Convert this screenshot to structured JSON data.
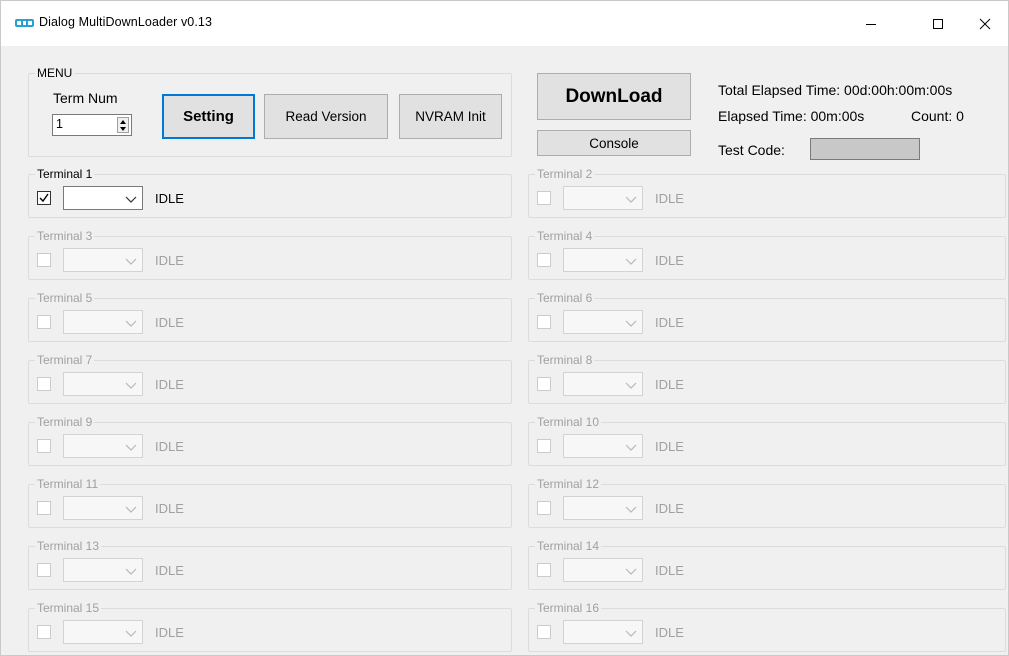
{
  "window": {
    "title": "Dialog MultiDownLoader v0.13"
  },
  "menu": {
    "legend": "MENU",
    "term_num_label": "Term Num",
    "term_num_value": "1",
    "setting_label": "Setting",
    "read_version_label": "Read Version",
    "nvram_init_label": "NVRAM Init"
  },
  "actions": {
    "download_label": "DownLoad",
    "console_label": "Console"
  },
  "info": {
    "total_elapsed": "Total Elapsed Time: 00d:00h:00m:00s",
    "elapsed": "Elapsed Time: 00m:00s",
    "count": "Count: 0",
    "test_code_label": "Test Code:"
  },
  "terminals": [
    {
      "name": "Terminal 1",
      "status": "IDLE",
      "checked": true,
      "enabled": true
    },
    {
      "name": "Terminal 2",
      "status": "IDLE",
      "checked": false,
      "enabled": false
    },
    {
      "name": "Terminal 3",
      "status": "IDLE",
      "checked": false,
      "enabled": false
    },
    {
      "name": "Terminal 4",
      "status": "IDLE",
      "checked": false,
      "enabled": false
    },
    {
      "name": "Terminal 5",
      "status": "IDLE",
      "checked": false,
      "enabled": false
    },
    {
      "name": "Terminal 6",
      "status": "IDLE",
      "checked": false,
      "enabled": false
    },
    {
      "name": "Terminal 7",
      "status": "IDLE",
      "checked": false,
      "enabled": false
    },
    {
      "name": "Terminal 8",
      "status": "IDLE",
      "checked": false,
      "enabled": false
    },
    {
      "name": "Terminal 9",
      "status": "IDLE",
      "checked": false,
      "enabled": false
    },
    {
      "name": "Terminal 10",
      "status": "IDLE",
      "checked": false,
      "enabled": false
    },
    {
      "name": "Terminal 11",
      "status": "IDLE",
      "checked": false,
      "enabled": false
    },
    {
      "name": "Terminal 12",
      "status": "IDLE",
      "checked": false,
      "enabled": false
    },
    {
      "name": "Terminal 13",
      "status": "IDLE",
      "checked": false,
      "enabled": false
    },
    {
      "name": "Terminal 14",
      "status": "IDLE",
      "checked": false,
      "enabled": false
    },
    {
      "name": "Terminal 15",
      "status": "IDLE",
      "checked": false,
      "enabled": false
    },
    {
      "name": "Terminal 16",
      "status": "IDLE",
      "checked": false,
      "enabled": false
    }
  ]
}
